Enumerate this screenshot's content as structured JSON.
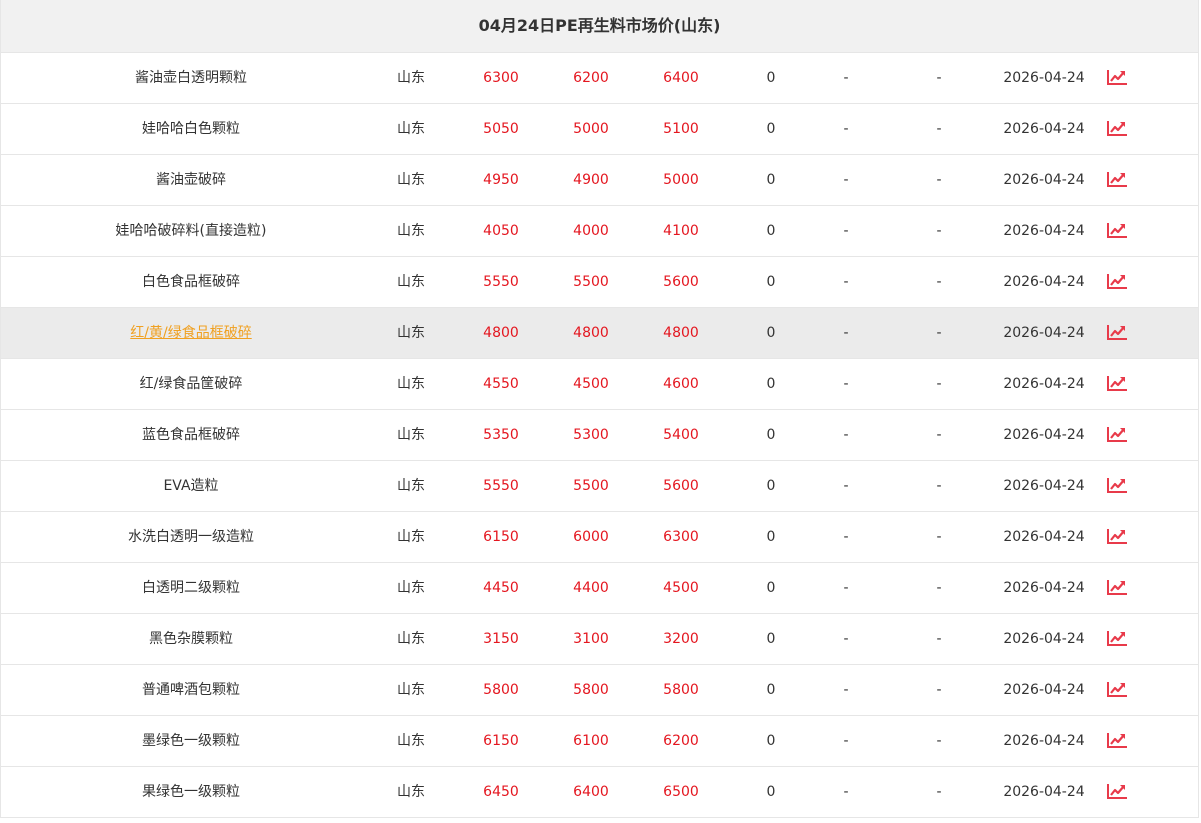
{
  "title": "04月24日PE再生料市场价(山东)",
  "colors": {
    "price": "#e4161f",
    "trend_icon": "#e83a4a",
    "highlight_link": "#f0a020",
    "header_bg": "#f1f1f1",
    "highlight_bg": "#ebebeb"
  },
  "rows": [
    {
      "name": "酱油壶白透明颗粒",
      "region": "山东",
      "p1": "6300",
      "p2": "6200",
      "p3": "6400",
      "change": "0",
      "d1": "-",
      "d2": "-",
      "date": "2026-04-24",
      "icon": "trend-chart-icon"
    },
    {
      "name": "娃哈哈白色颗粒",
      "region": "山东",
      "p1": "5050",
      "p2": "5000",
      "p3": "5100",
      "change": "0",
      "d1": "-",
      "d2": "-",
      "date": "2026-04-24",
      "icon": "trend-chart-icon"
    },
    {
      "name": "酱油壶破碎",
      "region": "山东",
      "p1": "4950",
      "p2": "4900",
      "p3": "5000",
      "change": "0",
      "d1": "-",
      "d2": "-",
      "date": "2026-04-24",
      "icon": "trend-chart-icon"
    },
    {
      "name": "娃哈哈破碎料(直接造粒)",
      "region": "山东",
      "p1": "4050",
      "p2": "4000",
      "p3": "4100",
      "change": "0",
      "d1": "-",
      "d2": "-",
      "date": "2026-04-24",
      "icon": "trend-chart-icon"
    },
    {
      "name": "白色食品框破碎",
      "region": "山东",
      "p1": "5550",
      "p2": "5500",
      "p3": "5600",
      "change": "0",
      "d1": "-",
      "d2": "-",
      "date": "2026-04-24",
      "icon": "trend-chart-icon"
    },
    {
      "name": "红/黄/绿食品框破碎",
      "region": "山东",
      "p1": "4800",
      "p2": "4800",
      "p3": "4800",
      "change": "0",
      "d1": "-",
      "d2": "-",
      "date": "2026-04-24",
      "icon": "trend-chart-icon",
      "highlighted": true
    },
    {
      "name": "红/绿食品筐破碎",
      "region": "山东",
      "p1": "4550",
      "p2": "4500",
      "p3": "4600",
      "change": "0",
      "d1": "-",
      "d2": "-",
      "date": "2026-04-24",
      "icon": "trend-chart-icon"
    },
    {
      "name": "蓝色食品框破碎",
      "region": "山东",
      "p1": "5350",
      "p2": "5300",
      "p3": "5400",
      "change": "0",
      "d1": "-",
      "d2": "-",
      "date": "2026-04-24",
      "icon": "trend-chart-icon"
    },
    {
      "name": "EVA造粒",
      "region": "山东",
      "p1": "5550",
      "p2": "5500",
      "p3": "5600",
      "change": "0",
      "d1": "-",
      "d2": "-",
      "date": "2026-04-24",
      "icon": "trend-chart-icon"
    },
    {
      "name": "水洗白透明一级造粒",
      "region": "山东",
      "p1": "6150",
      "p2": "6000",
      "p3": "6300",
      "change": "0",
      "d1": "-",
      "d2": "-",
      "date": "2026-04-24",
      "icon": "trend-chart-icon"
    },
    {
      "name": "白透明二级颗粒",
      "region": "山东",
      "p1": "4450",
      "p2": "4400",
      "p3": "4500",
      "change": "0",
      "d1": "-",
      "d2": "-",
      "date": "2026-04-24",
      "icon": "trend-chart-icon"
    },
    {
      "name": "黑色杂膜颗粒",
      "region": "山东",
      "p1": "3150",
      "p2": "3100",
      "p3": "3200",
      "change": "0",
      "d1": "-",
      "d2": "-",
      "date": "2026-04-24",
      "icon": "trend-chart-icon"
    },
    {
      "name": "普通啤酒包颗粒",
      "region": "山东",
      "p1": "5800",
      "p2": "5800",
      "p3": "5800",
      "change": "0",
      "d1": "-",
      "d2": "-",
      "date": "2026-04-24",
      "icon": "trend-chart-icon"
    },
    {
      "name": "墨绿色一级颗粒",
      "region": "山东",
      "p1": "6150",
      "p2": "6100",
      "p3": "6200",
      "change": "0",
      "d1": "-",
      "d2": "-",
      "date": "2026-04-24",
      "icon": "trend-chart-icon"
    },
    {
      "name": "果绿色一级颗粒",
      "region": "山东",
      "p1": "6450",
      "p2": "6400",
      "p3": "6500",
      "change": "0",
      "d1": "-",
      "d2": "-",
      "date": "2026-04-24",
      "icon": "trend-chart-icon"
    }
  ]
}
